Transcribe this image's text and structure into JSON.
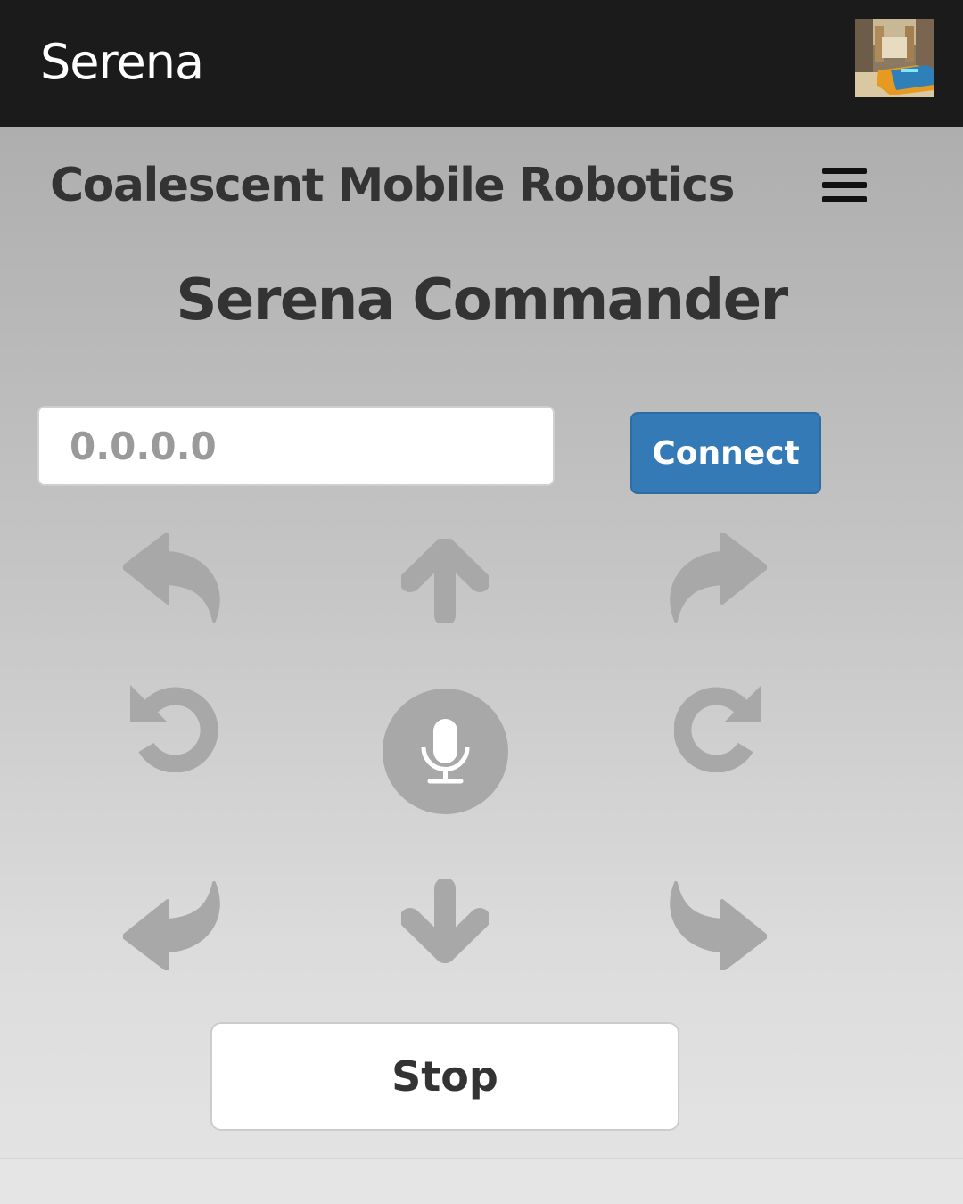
{
  "app_bar": {
    "title": "Serena",
    "thumbnail_icon": "robot-photo-thumbnail"
  },
  "navbar": {
    "brand": "Coalescent Mobile Robotics",
    "menu_icon": "hamburger-menu-icon"
  },
  "main": {
    "title": "Serena Commander",
    "ip_input": {
      "placeholder": "0.0.0.0",
      "value": ""
    },
    "connect_label": "Connect",
    "controls": [
      {
        "name": "forward-left",
        "icon": "reply-arrow-icon"
      },
      {
        "name": "forward",
        "icon": "arrow-up-icon"
      },
      {
        "name": "forward-right",
        "icon": "share-arrow-icon"
      },
      {
        "name": "rotate-left",
        "icon": "rotate-ccw-icon"
      },
      {
        "name": "voice",
        "icon": "microphone-icon"
      },
      {
        "name": "rotate-right",
        "icon": "rotate-cw-icon"
      },
      {
        "name": "backward-left",
        "icon": "curved-arrow-down-left-icon"
      },
      {
        "name": "backward",
        "icon": "arrow-down-icon"
      },
      {
        "name": "backward-right",
        "icon": "curved-arrow-down-right-icon"
      }
    ],
    "stop_label": "Stop"
  },
  "colors": {
    "app_bar": "#1b1b1b",
    "connect_button": "#337ab7",
    "control_icons": "#a8a8a8",
    "text_dark": "#333333"
  }
}
